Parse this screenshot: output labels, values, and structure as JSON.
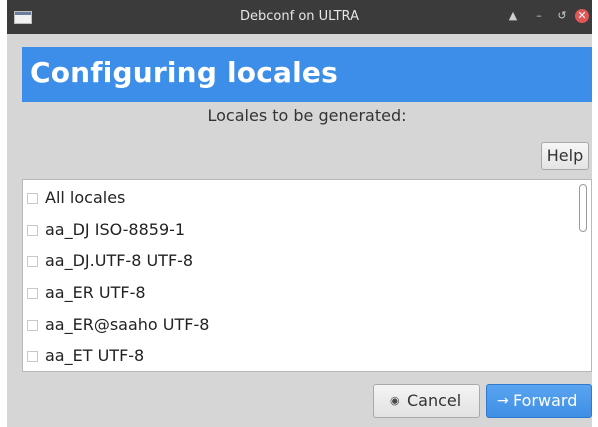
{
  "window": {
    "title": "Debconf on ULTRA",
    "controls": {
      "up": "▲",
      "minimize": "–",
      "restore": "↺",
      "close": "✕"
    }
  },
  "banner": {
    "title": "Configuring locales",
    "color": "#3d8ee9"
  },
  "prompt": "Locales to be generated:",
  "help_button": "Help",
  "locales": [
    {
      "label": "All locales",
      "checked": false
    },
    {
      "label": "aa_DJ ISO-8859-1",
      "checked": false
    },
    {
      "label": "aa_DJ.UTF-8 UTF-8",
      "checked": false
    },
    {
      "label": "aa_ER UTF-8",
      "checked": false
    },
    {
      "label": "aa_ER@saaho UTF-8",
      "checked": false
    },
    {
      "label": "aa_ET UTF-8",
      "checked": false
    }
  ],
  "buttons": {
    "cancel": {
      "label": "Cancel",
      "icon": "cancel-radio-icon"
    },
    "forward": {
      "label": "Forward",
      "icon": "arrow-right-icon",
      "color": "#3f8fe6"
    }
  }
}
